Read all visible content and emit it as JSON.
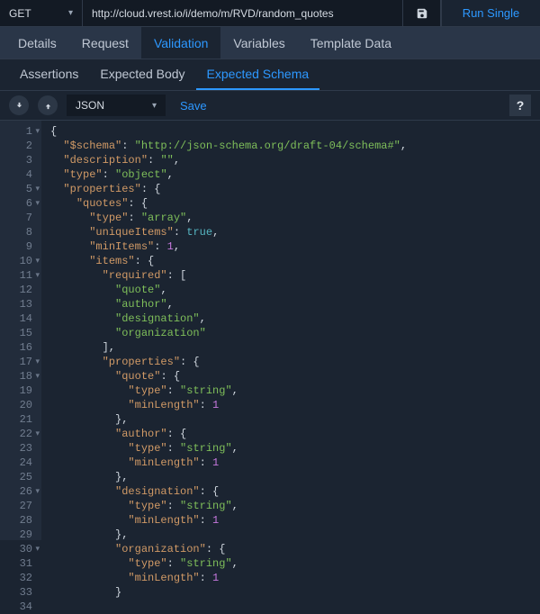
{
  "top": {
    "method": "GET",
    "url": "http://cloud.vrest.io/i/demo/m/RVD/random_quotes",
    "run": "Run Single"
  },
  "tabs1": [
    "Details",
    "Request",
    "Validation",
    "Variables",
    "Template Data"
  ],
  "tabs1_active": 2,
  "tabs2": [
    "Assertions",
    "Expected Body",
    "Expected Schema"
  ],
  "tabs2_active": 2,
  "toolbar": {
    "format": "JSON",
    "save": "Save",
    "help": "?"
  },
  "schema": {
    "$schema": "http://json-schema.org/draft-04/schema#",
    "description": "",
    "type": "object",
    "properties": {
      "quotes": {
        "type": "array",
        "uniqueItems": true,
        "minItems": 1,
        "items": {
          "required": [
            "quote",
            "author",
            "designation",
            "organization"
          ],
          "properties": {
            "quote": {
              "type": "string",
              "minLength": 1
            },
            "author": {
              "type": "string",
              "minLength": 1
            },
            "designation": {
              "type": "string",
              "minLength": 1
            },
            "organization": {
              "type": "string",
              "minLength": 1
            }
          }
        }
      }
    }
  },
  "code_lines": [
    {
      "n": 1,
      "f": true,
      "t": [
        [
          "p",
          "{"
        ]
      ]
    },
    {
      "n": 2,
      "f": false,
      "t": [
        [
          "p",
          "  "
        ],
        [
          "k",
          "\"$schema\""
        ],
        [
          "p",
          ": "
        ],
        [
          "s",
          "\"http://json-schema.org/draft-04/schema#\""
        ],
        [
          "p",
          ","
        ]
      ]
    },
    {
      "n": 3,
      "f": false,
      "t": [
        [
          "p",
          "  "
        ],
        [
          "k",
          "\"description\""
        ],
        [
          "p",
          ": "
        ],
        [
          "s",
          "\"\""
        ],
        [
          "p",
          ","
        ]
      ]
    },
    {
      "n": 4,
      "f": false,
      "t": [
        [
          "p",
          "  "
        ],
        [
          "k",
          "\"type\""
        ],
        [
          "p",
          ": "
        ],
        [
          "s",
          "\"object\""
        ],
        [
          "p",
          ","
        ]
      ]
    },
    {
      "n": 5,
      "f": true,
      "t": [
        [
          "p",
          "  "
        ],
        [
          "k",
          "\"properties\""
        ],
        [
          "p",
          ": {"
        ]
      ]
    },
    {
      "n": 6,
      "f": true,
      "t": [
        [
          "p",
          "    "
        ],
        [
          "k",
          "\"quotes\""
        ],
        [
          "p",
          ": {"
        ]
      ]
    },
    {
      "n": 7,
      "f": false,
      "t": [
        [
          "p",
          "      "
        ],
        [
          "k",
          "\"type\""
        ],
        [
          "p",
          ": "
        ],
        [
          "s",
          "\"array\""
        ],
        [
          "p",
          ","
        ]
      ]
    },
    {
      "n": 8,
      "f": false,
      "t": [
        [
          "p",
          "      "
        ],
        [
          "k",
          "\"uniqueItems\""
        ],
        [
          "p",
          ": "
        ],
        [
          "b",
          "true"
        ],
        [
          "p",
          ","
        ]
      ]
    },
    {
      "n": 9,
      "f": false,
      "t": [
        [
          "p",
          "      "
        ],
        [
          "k",
          "\"minItems\""
        ],
        [
          "p",
          ": "
        ],
        [
          "n",
          "1"
        ],
        [
          "p",
          ","
        ]
      ]
    },
    {
      "n": 10,
      "f": true,
      "t": [
        [
          "p",
          "      "
        ],
        [
          "k",
          "\"items\""
        ],
        [
          "p",
          ": {"
        ]
      ]
    },
    {
      "n": 11,
      "f": true,
      "t": [
        [
          "p",
          "        "
        ],
        [
          "k",
          "\"required\""
        ],
        [
          "p",
          ": ["
        ]
      ]
    },
    {
      "n": 12,
      "f": false,
      "t": [
        [
          "p",
          "          "
        ],
        [
          "s",
          "\"quote\""
        ],
        [
          "p",
          ","
        ]
      ]
    },
    {
      "n": 13,
      "f": false,
      "t": [
        [
          "p",
          "          "
        ],
        [
          "s",
          "\"author\""
        ],
        [
          "p",
          ","
        ]
      ]
    },
    {
      "n": 14,
      "f": false,
      "t": [
        [
          "p",
          "          "
        ],
        [
          "s",
          "\"designation\""
        ],
        [
          "p",
          ","
        ]
      ]
    },
    {
      "n": 15,
      "f": false,
      "t": [
        [
          "p",
          "          "
        ],
        [
          "s",
          "\"organization\""
        ]
      ]
    },
    {
      "n": 16,
      "f": false,
      "t": [
        [
          "p",
          "        ],"
        ]
      ]
    },
    {
      "n": 17,
      "f": true,
      "t": [
        [
          "p",
          "        "
        ],
        [
          "k",
          "\"properties\""
        ],
        [
          "p",
          ": {"
        ]
      ]
    },
    {
      "n": 18,
      "f": true,
      "t": [
        [
          "p",
          "          "
        ],
        [
          "k",
          "\"quote\""
        ],
        [
          "p",
          ": {"
        ]
      ]
    },
    {
      "n": 19,
      "f": false,
      "t": [
        [
          "p",
          "            "
        ],
        [
          "k",
          "\"type\""
        ],
        [
          "p",
          ": "
        ],
        [
          "s",
          "\"string\""
        ],
        [
          "p",
          ","
        ]
      ]
    },
    {
      "n": 20,
      "f": false,
      "t": [
        [
          "p",
          "            "
        ],
        [
          "k",
          "\"minLength\""
        ],
        [
          "p",
          ": "
        ],
        [
          "n",
          "1"
        ]
      ]
    },
    {
      "n": 21,
      "f": false,
      "t": [
        [
          "p",
          "          },"
        ]
      ]
    },
    {
      "n": 22,
      "f": true,
      "t": [
        [
          "p",
          "          "
        ],
        [
          "k",
          "\"author\""
        ],
        [
          "p",
          ": {"
        ]
      ]
    },
    {
      "n": 23,
      "f": false,
      "t": [
        [
          "p",
          "            "
        ],
        [
          "k",
          "\"type\""
        ],
        [
          "p",
          ": "
        ],
        [
          "s",
          "\"string\""
        ],
        [
          "p",
          ","
        ]
      ]
    },
    {
      "n": 24,
      "f": false,
      "t": [
        [
          "p",
          "            "
        ],
        [
          "k",
          "\"minLength\""
        ],
        [
          "p",
          ": "
        ],
        [
          "n",
          "1"
        ]
      ]
    },
    {
      "n": 25,
      "f": false,
      "t": [
        [
          "p",
          "          },"
        ]
      ]
    },
    {
      "n": 26,
      "f": true,
      "t": [
        [
          "p",
          "          "
        ],
        [
          "k",
          "\"designation\""
        ],
        [
          "p",
          ": {"
        ]
      ]
    },
    {
      "n": 27,
      "f": false,
      "t": [
        [
          "p",
          "            "
        ],
        [
          "k",
          "\"type\""
        ],
        [
          "p",
          ": "
        ],
        [
          "s",
          "\"string\""
        ],
        [
          "p",
          ","
        ]
      ]
    },
    {
      "n": 28,
      "f": false,
      "t": [
        [
          "p",
          "            "
        ],
        [
          "k",
          "\"minLength\""
        ],
        [
          "p",
          ": "
        ],
        [
          "n",
          "1"
        ]
      ]
    },
    {
      "n": 29,
      "f": false,
      "t": [
        [
          "p",
          "          },"
        ]
      ]
    },
    {
      "n": 30,
      "f": true,
      "t": [
        [
          "p",
          "          "
        ],
        [
          "k",
          "\"organization\""
        ],
        [
          "p",
          ": {"
        ]
      ]
    },
    {
      "n": 31,
      "f": false,
      "t": [
        [
          "p",
          "            "
        ],
        [
          "k",
          "\"type\""
        ],
        [
          "p",
          ": "
        ],
        [
          "s",
          "\"string\""
        ],
        [
          "p",
          ","
        ]
      ]
    },
    {
      "n": 32,
      "f": false,
      "t": [
        [
          "p",
          "            "
        ],
        [
          "k",
          "\"minLength\""
        ],
        [
          "p",
          ": "
        ],
        [
          "n",
          "1"
        ]
      ]
    },
    {
      "n": 33,
      "f": false,
      "t": [
        [
          "p",
          "          }"
        ]
      ]
    },
    {
      "n": 34,
      "f": false,
      "t": [
        [
          "p",
          ""
        ]
      ]
    }
  ]
}
